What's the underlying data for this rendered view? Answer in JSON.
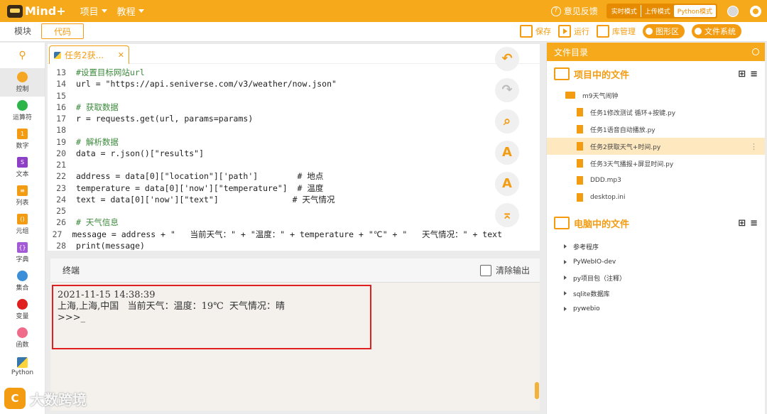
{
  "app": {
    "logo_text": "Mind+",
    "menu": [
      {
        "label": "项目"
      },
      {
        "label": "教程"
      }
    ],
    "feedback_label": "意见反馈",
    "modes": [
      "实时模式",
      "上传模式",
      "Python模式"
    ]
  },
  "mode_tabs": {
    "blocks": "模块",
    "code": "代码"
  },
  "toolbar": {
    "save": "保存",
    "run": "运行",
    "library": "库管理",
    "graphics": "图形区",
    "filesystem": "文件系统"
  },
  "sidebar": {
    "items": [
      {
        "label": "控制",
        "color": "#f5a623"
      },
      {
        "label": "运算符",
        "color": "#2db54a"
      },
      {
        "label": "数字",
        "color": "#f39c12"
      },
      {
        "label": "文本",
        "color": "#8e3fc7"
      },
      {
        "label": "列表",
        "color": "#f39c12"
      },
      {
        "label": "元组",
        "color": "#f39c12"
      },
      {
        "label": "字典",
        "color": "#a45ad6"
      },
      {
        "label": "集合",
        "color": "#3b8fd9"
      },
      {
        "label": "变量",
        "color": "#e02020"
      },
      {
        "label": "函数",
        "color": "#f06a8a"
      },
      {
        "label": "Python",
        "color": "#3776ab"
      }
    ]
  },
  "editor": {
    "tab_label": "任务2获...",
    "lines": [
      {
        "n": "13",
        "text": "#设置目标网站url",
        "kind": "comment"
      },
      {
        "n": "14",
        "text": "url = \"https://api.seniverse.com/v3/weather/now.json\"",
        "kind": "code"
      },
      {
        "n": "15",
        "text": "",
        "kind": "code"
      },
      {
        "n": "16",
        "text": "# 获取数据",
        "kind": "comment"
      },
      {
        "n": "17",
        "text": "r = requests.get(url, params=params)",
        "kind": "code"
      },
      {
        "n": "18",
        "text": "",
        "kind": "code"
      },
      {
        "n": "19",
        "text": "# 解析数据",
        "kind": "comment"
      },
      {
        "n": "20",
        "text": "data = r.json()[\"results\"]",
        "kind": "code"
      },
      {
        "n": "21",
        "text": "",
        "kind": "code"
      },
      {
        "n": "22",
        "text": "address = data[0][\"location\"]['path']        # 地点",
        "kind": "code"
      },
      {
        "n": "23",
        "text": "temperature = data[0]['now'][\"temperature\"]  # 温度",
        "kind": "code"
      },
      {
        "n": "24",
        "text": "text = data[0]['now'][\"text\"]               # 天气情况",
        "kind": "code"
      },
      {
        "n": "25",
        "text": "",
        "kind": "code"
      },
      {
        "n": "26",
        "text": "# 天气信息",
        "kind": "comment"
      },
      {
        "n": "27",
        "text": "message = address + \"   当前天气：\" + \"温度：\" + temperature + \"℃\" + \"   天气情况：\" + text",
        "kind": "code"
      },
      {
        "n": "28",
        "text": "print(message)",
        "kind": "code"
      }
    ]
  },
  "terminal": {
    "title": "终端",
    "clear_label": "清除输出",
    "output": [
      "2021-11-15 14:38:39",
      "上海,上海,中国   当前天气：温度：19℃  天气情况：晴",
      ">>>_"
    ]
  },
  "files": {
    "panel_title": "文件目录",
    "project_title": "项目中的文件",
    "folder": "m9天气闹钟",
    "project_files": [
      {
        "name": "任务1修改测试 循环+按键.py",
        "active": false
      },
      {
        "name": "任务1语音自动播放.py",
        "active": false
      },
      {
        "name": "任务2获取天气+时间.py",
        "active": true
      },
      {
        "name": "任务3天气播报+屏显时间.py",
        "active": false
      },
      {
        "name": "DDD.mp3",
        "active": false
      },
      {
        "name": "desktop.ini",
        "active": false
      }
    ],
    "pc_title": "电脑中的文件",
    "pc_items": [
      "参考程序",
      "PyWebIO-dev",
      "py项目包（注释）",
      "sqlite数据库",
      "pywebio"
    ]
  },
  "watermark": {
    "text": "大数跨境"
  },
  "colors": {
    "accent": "#f7a91c",
    "highlight_box": "#e02020"
  }
}
